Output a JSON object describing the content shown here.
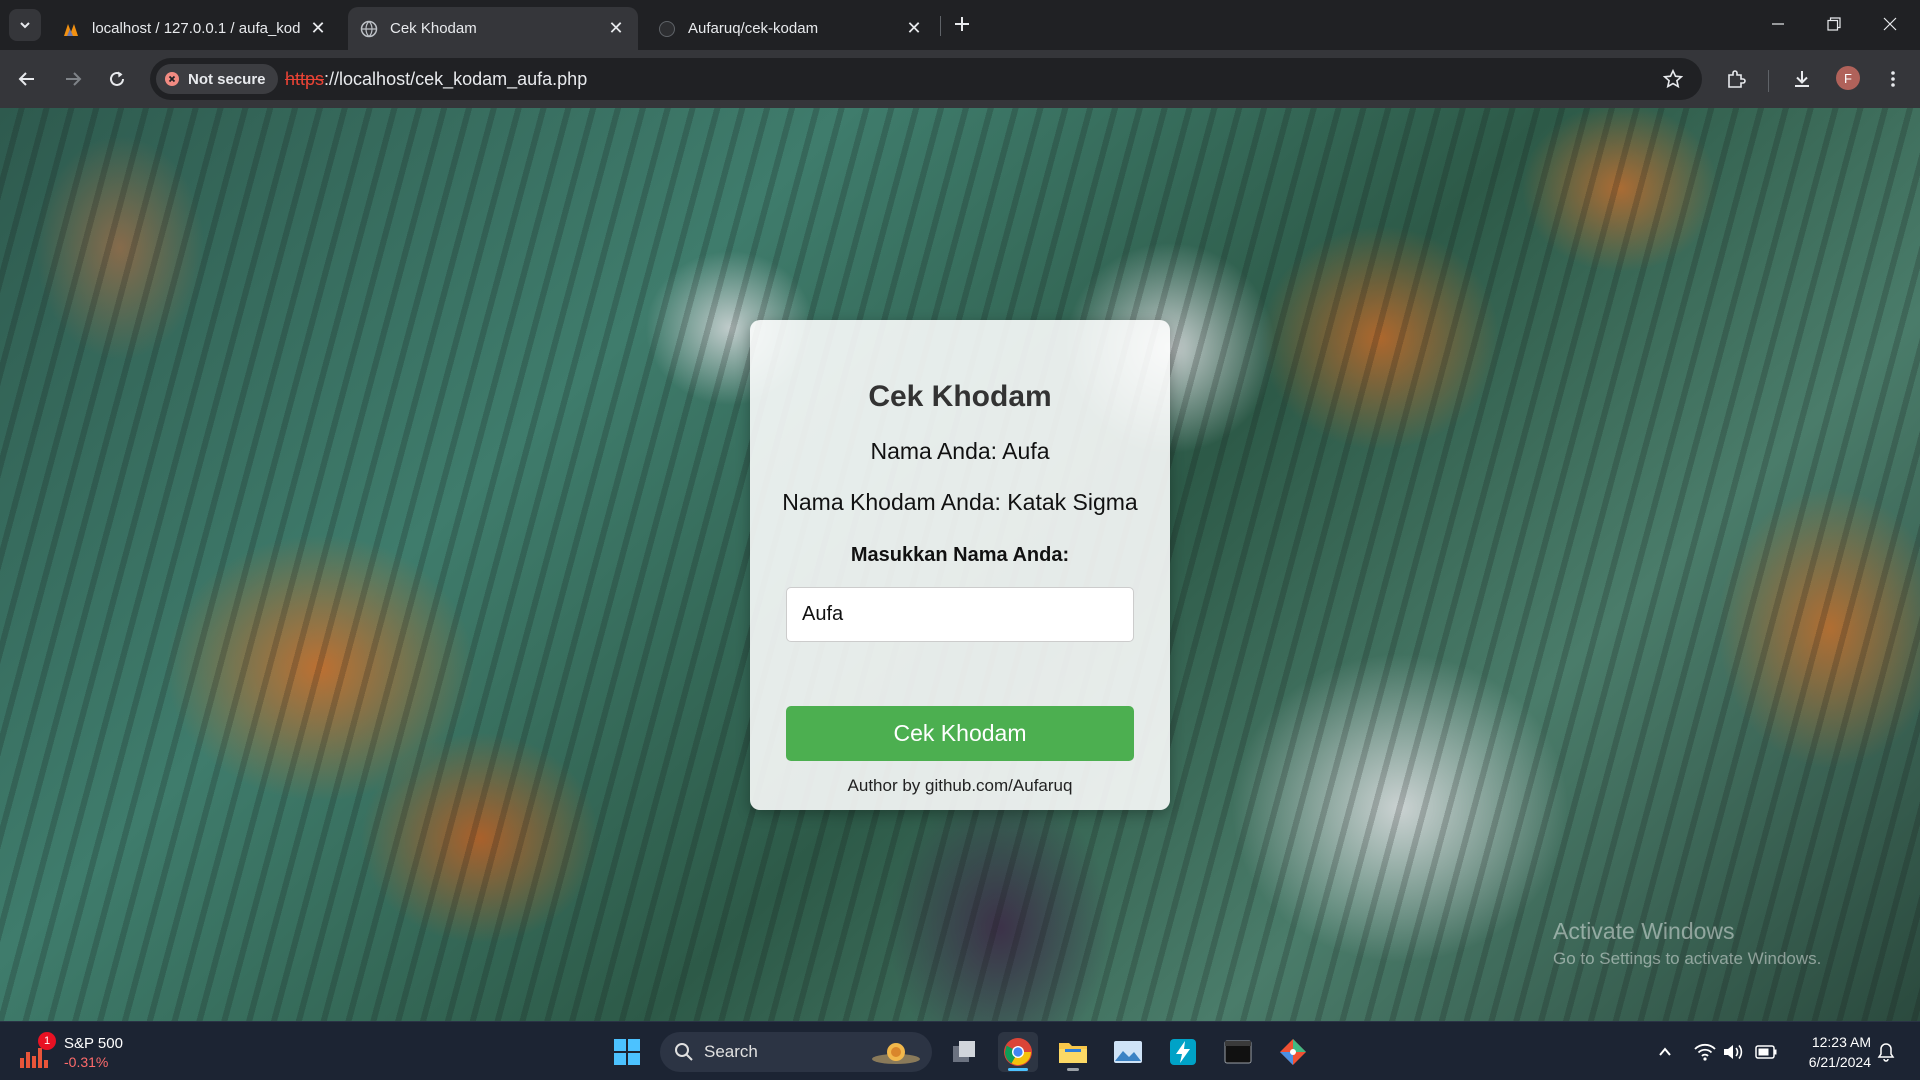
{
  "browser": {
    "tabs": [
      {
        "title": "localhost / 127.0.0.1 / aufa_kod",
        "favicon": "phpmyadmin-icon",
        "active": false
      },
      {
        "title": "Cek Khodam",
        "favicon": "globe-icon",
        "active": true
      },
      {
        "title": "Aufaruq/cek-kodam",
        "favicon": "github-icon",
        "active": false
      }
    ],
    "security_label": "Not secure",
    "url_scheme": "https",
    "url_rest": "://localhost/cek_kodam_aufa.php",
    "profile_initial": "F"
  },
  "page": {
    "title": "Cek Khodam",
    "name_line": "Nama Anda: Aufa",
    "khodam_line": "Nama Khodam Anda: Katak Sigma",
    "input_label": "Masukkan Nama Anda:",
    "input_value": "Aufa",
    "submit_label": "Cek Khodam",
    "author": "Author by github.com/Aufaruq",
    "accent_color": "#4caf50"
  },
  "watermark": {
    "line1": "Activate Windows",
    "line2": "Go to Settings to activate Windows."
  },
  "taskbar": {
    "widget_name": "S&P 500",
    "widget_change": "-0.31%",
    "widget_badge": "1",
    "search_placeholder": "Search",
    "time": "12:23 AM",
    "date": "6/21/2024"
  }
}
